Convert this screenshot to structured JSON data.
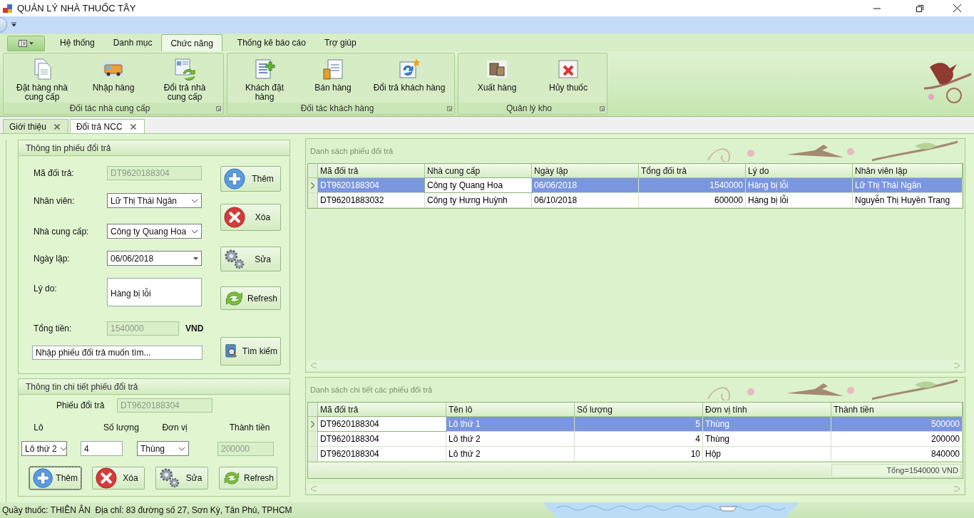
{
  "window": {
    "title": "QUẢN LÝ NHÀ THUỐC TÂY"
  },
  "ribbon": {
    "tabs": [
      {
        "label": "Hệ thống",
        "selected": false
      },
      {
        "label": "Danh mục",
        "selected": false
      },
      {
        "label": "Chức năng",
        "selected": true
      },
      {
        "label": "Thống kê báo cáo",
        "selected": false
      },
      {
        "label": "Trợ giúp",
        "selected": false
      }
    ],
    "groups": [
      {
        "label": "Đối tác nhà cung cấp",
        "buttons": [
          {
            "label": "Đặt hàng nhà cung cấp",
            "kind": "document"
          },
          {
            "label": "Nhập hàng",
            "kind": "truck"
          },
          {
            "label": "Đổi trả nhà cung cấp",
            "kind": "exchange"
          }
        ]
      },
      {
        "label": "Đối tác khách hàng",
        "buttons": [
          {
            "label": "Khách đặt hàng",
            "kind": "add-list"
          },
          {
            "label": "Bán hàng",
            "kind": "clipboard"
          },
          {
            "label": "Đổi trả khách hàng",
            "kind": "refresh-star"
          }
        ]
      },
      {
        "label": "Quản lý kho",
        "buttons": [
          {
            "label": "Xuất hàng",
            "kind": "boxes"
          },
          {
            "label": "Hủy thuốc",
            "kind": "cancel"
          }
        ]
      }
    ]
  },
  "doc_tabs": [
    {
      "label": "Giới thiệu",
      "selected": false
    },
    {
      "label": "Đổi trả NCC",
      "selected": true
    }
  ],
  "form": {
    "title": "Thông tin phiếu đổi trả",
    "fields": [
      {
        "label": "Mã đối trả:",
        "kind": "readonly",
        "value": "DT9620188304"
      },
      {
        "label": "Nhân viên:",
        "kind": "select",
        "value": "Lữ Thị Thái Ngân"
      },
      {
        "label": "Nhà cung cấp:",
        "kind": "select",
        "value": "Công ty Quang Hoa"
      },
      {
        "label": "Ngày lập:",
        "kind": "date",
        "value": "06/06/2018"
      },
      {
        "label": "Lý do:",
        "kind": "textarea",
        "value": "Hàng bị lỗi"
      },
      {
        "label": "Tổng tiền:",
        "kind": "readonly",
        "value": "1540000",
        "unit": "VND"
      }
    ],
    "search": {
      "value": "Nhập phiếu đổi trả muốn tìm..."
    },
    "buttons": [
      {
        "label": "Thêm",
        "kind": "add"
      },
      {
        "label": "Xóa",
        "kind": "delete"
      },
      {
        "label": "Sửa",
        "kind": "edit"
      },
      {
        "label": "Refresh",
        "kind": "refresh"
      },
      {
        "label": "Tìm kiếm",
        "kind": "search"
      }
    ]
  },
  "detail_form": {
    "title": "Thông tin chi tiết phiếu đổi trả",
    "receipt": {
      "label": "Phiếu đổi trả",
      "value": "DT9620188304"
    },
    "fields": [
      {
        "label": "Lô",
        "kind": "select",
        "value": "Lô thứ 2"
      },
      {
        "label": "Số lượng",
        "kind": "text",
        "value": "4"
      },
      {
        "label": "Đơn vị",
        "kind": "select",
        "value": "Thùng"
      },
      {
        "label": "Thành tiền",
        "kind": "readonly",
        "value": "200000"
      }
    ],
    "buttons": [
      {
        "label": "Thêm",
        "kind": "add",
        "focused": true
      },
      {
        "label": "Xóa",
        "kind": "delete",
        "focused": false
      },
      {
        "label": "Sửa",
        "kind": "edit",
        "focused": false
      },
      {
        "label": "Refresh",
        "kind": "refresh",
        "focused": false
      }
    ]
  },
  "receipts_table": {
    "title": "Danh sách phiếu đổi trả",
    "columns": [
      {
        "label": "Mã đối trả",
        "numeric": false
      },
      {
        "label": "Nhà cung cấp",
        "numeric": false
      },
      {
        "label": "Ngày lập",
        "numeric": false
      },
      {
        "label": "Tổng đối trả",
        "numeric": true
      },
      {
        "label": "Lý do",
        "numeric": false
      },
      {
        "label": "Nhân viên lập",
        "numeric": false
      }
    ],
    "rows": [
      {
        "selected": true,
        "cells": [
          {
            "text": "DT9620188304",
            "current": false
          },
          {
            "text": "Công ty Quang Hoa",
            "current": true
          },
          {
            "text": "06/06/2018",
            "current": false
          },
          {
            "text": "1540000",
            "current": false
          },
          {
            "text": "Hàng bị lỗi",
            "current": false
          },
          {
            "text": "Lữ Thị Thái Ngân",
            "current": false
          }
        ]
      },
      {
        "selected": false,
        "cells": [
          {
            "text": "DT96201883032",
            "current": false
          },
          {
            "text": "Công ty Hưng Huỳnh",
            "current": false
          },
          {
            "text": "06/10/2018",
            "current": false
          },
          {
            "text": "600000",
            "current": false
          },
          {
            "text": "Hàng bị lỗi",
            "current": false
          },
          {
            "text": "Nguyễn Thị Huyền Trang",
            "current": false
          }
        ]
      }
    ]
  },
  "details_table": {
    "title": "Danh sách chi tiết các phiếu đổi trả",
    "columns": [
      {
        "label": "Mã đối trả",
        "numeric": false
      },
      {
        "label": "Tên lô",
        "numeric": false
      },
      {
        "label": "Số lượng",
        "numeric": true
      },
      {
        "label": "Đơn vị tính",
        "numeric": false
      },
      {
        "label": "Thành tiền",
        "numeric": true
      }
    ],
    "rows": [
      {
        "selected": true,
        "cells": [
          {
            "text": "DT9620188304",
            "current": true
          },
          {
            "text": "Lô thứ 1",
            "current": false
          },
          {
            "text": "5",
            "current": false
          },
          {
            "text": "Thùng",
            "current": false
          },
          {
            "text": "500000",
            "current": false
          }
        ]
      },
      {
        "selected": false,
        "cells": [
          {
            "text": "DT9620188304",
            "current": false
          },
          {
            "text": "Lô thứ 2",
            "current": false
          },
          {
            "text": "4",
            "current": false
          },
          {
            "text": "Thùng",
            "current": false
          },
          {
            "text": "200000",
            "current": false
          }
        ]
      },
      {
        "selected": false,
        "cells": [
          {
            "text": "DT9620188304",
            "current": false
          },
          {
            "text": "Lô thứ 2",
            "current": false
          },
          {
            "text": "10",
            "current": false
          },
          {
            "text": "Hộp",
            "current": false
          },
          {
            "text": "840000",
            "current": false
          }
        ]
      }
    ],
    "total": "Tổng=1540000 VND"
  },
  "status_bar": {
    "text": "Quầy thuốc: THIÊN ÂN  Địa chỉ: 83 đường số 27, Sơn Kỳ, Tân Phú, TPHCM"
  }
}
